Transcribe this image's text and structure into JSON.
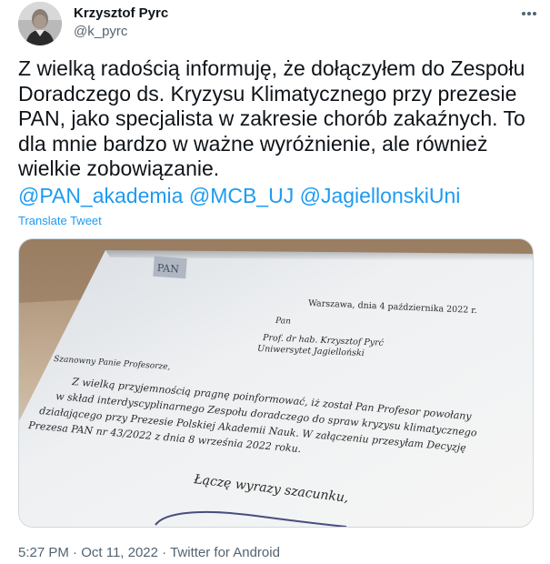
{
  "author": {
    "name": "Krzysztof Pyrc",
    "handle": "@k_pyrc"
  },
  "tweet": {
    "text": "Z wielką radością informuję, że dołączyłem do Zespołu Doradczego ds. Kryzysu Klimatycznego przy prezesie PAN, jako specjalista w zakresie chorób zakaźnych. To dla mnie bardzo w ważne wyróżnienie, ale również wielkie zobowiązanie.",
    "mentions": [
      "@PAN_akademia",
      "@MCB_UJ",
      "@JagiellonskiUni"
    ],
    "translate_label": "Translate Tweet"
  },
  "letter": {
    "date_line": "Warszawa, dnia 4 października 2022 r.",
    "recipient": [
      "Pan",
      "Prof. dr hab. Krzysztof Pyrć",
      "Uniwersytet Jagielloński"
    ],
    "salutation": "Szanowny Panie Profesorze,",
    "body": [
      "Z wielką przyjemnością pragnę poinformować, iż został Pan Profesor powołany",
      "w skład interdyscyplinarnego Zespołu doradczego do spraw kryzysu klimatycznego",
      "działającego przy Prezesie Polskiej Akademii Nauk. W załączeniu przesyłam Decyzję",
      "Prezesa PAN nr 43/2022 z dnia 8 września 2022 roku."
    ],
    "closing": "Łączę wyrazy szacunku,"
  },
  "meta": {
    "time": "5:27 PM",
    "date": "Oct 11, 2022",
    "source": "Twitter for Android",
    "separator": " · "
  },
  "colors": {
    "link": "#1d9bf0",
    "secondary_text": "#536471",
    "primary_text": "#0f1419",
    "border": "#cfd9de"
  }
}
